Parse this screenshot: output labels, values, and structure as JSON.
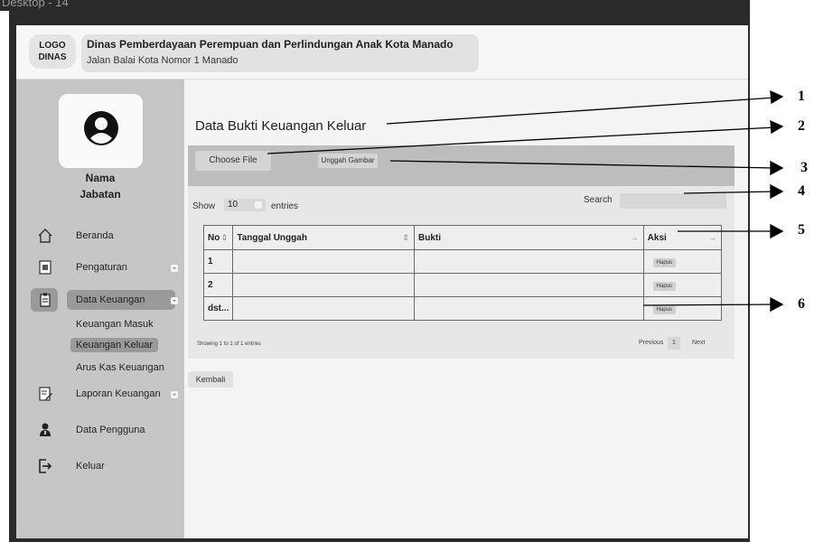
{
  "window": {
    "title": "Desktop - 14"
  },
  "header": {
    "logo": "LOGO DINAS",
    "agency_name": "Dinas Pemberdayaan Perempuan dan Perlindungan Anak Kota Manado",
    "address": "Jalan Balai Kota Nomor 1 Manado"
  },
  "sidebar": {
    "user_name": "Nama",
    "user_role": "Jabatan",
    "items": [
      {
        "label": "Beranda",
        "icon": "home-icon"
      },
      {
        "label": "Pengaturan",
        "icon": "document-icon"
      },
      {
        "label": "Data Keuangan",
        "icon": "clipboard-icon"
      },
      {
        "label": "Laporan Keuangan",
        "icon": "edit-icon"
      },
      {
        "label": "Data Pengguna",
        "icon": "user-icon"
      },
      {
        "label": "Keluar",
        "icon": "logout-icon"
      }
    ],
    "submenu": [
      "Keuangan Masuk",
      "Keuangan Keluar",
      "Arus Kas Keuangan"
    ]
  },
  "main": {
    "title": "Data Bukti Keuangan Keluar",
    "choose_file": "Choose File",
    "upload": "Unggah Gambar",
    "show": "Show",
    "entries_value": "10",
    "entries": "entries",
    "search": "Search",
    "columns": [
      "No",
      "Tanggal Unggah",
      "Bukti",
      "Aksi"
    ],
    "rows": [
      {
        "no": "1",
        "tanggal": "",
        "bukti": "",
        "aksi": "Hapus"
      },
      {
        "no": "2",
        "tanggal": "",
        "bukti": "",
        "aksi": "Hapus"
      },
      {
        "no": "dst...",
        "tanggal": "",
        "bukti": "",
        "aksi": "Hapus"
      }
    ],
    "showing": "Showing 1 to 1 of 1 entries",
    "pagination": {
      "previous": "Previous",
      "page": "1",
      "next": "Next"
    },
    "back": "Kembali"
  },
  "annotations": [
    "1",
    "2",
    "3",
    "4",
    "5",
    "6"
  ],
  "colors": {
    "frame": "#2a2a2a",
    "sidebar": "#c6c6c6",
    "active": "#9a9a9a",
    "panel": "#e7e7e7",
    "upload_bar": "#bdbdbd"
  }
}
